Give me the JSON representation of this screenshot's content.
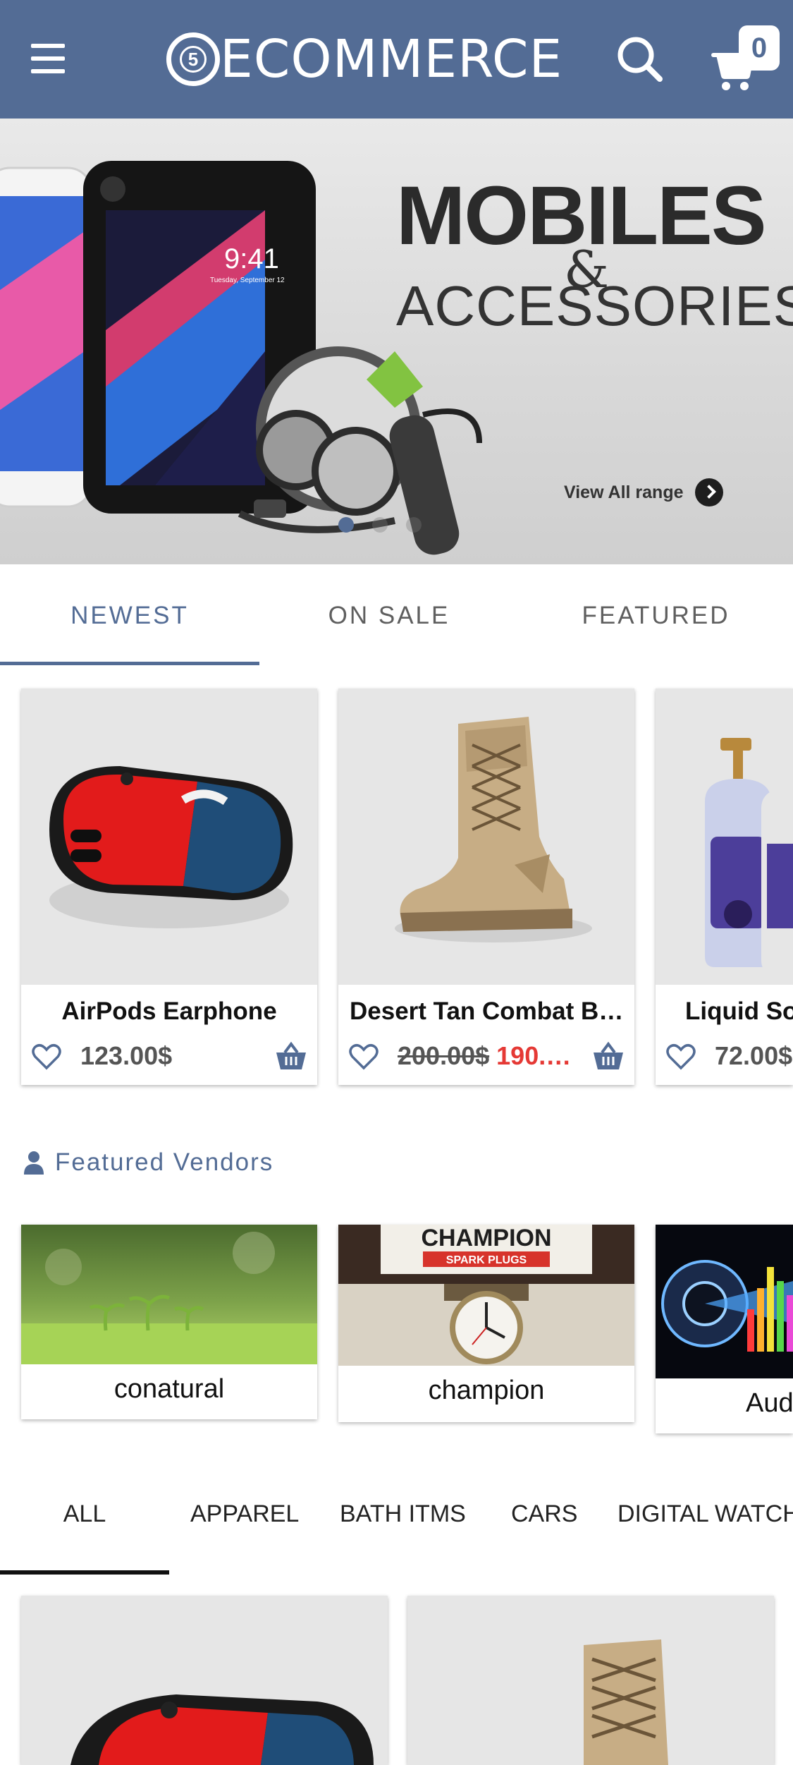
{
  "app_bar": {
    "brand_badge": "5",
    "brand_name": "ECOMMERCE",
    "cart_count": "0",
    "icons": [
      "menu-icon",
      "search-icon",
      "cart-icon"
    ],
    "color": "#536c95"
  },
  "banner": {
    "title": "MOBILES",
    "amp": "&",
    "subtitle": "ACCESSORIES",
    "phone_time": "9:41",
    "phone_date": "Tuesday, September 12",
    "link": "View All range",
    "slides": 3,
    "active_slide": 1
  },
  "product_tabs": [
    {
      "label": "NEWEST",
      "active": true
    },
    {
      "label": "ON SALE",
      "active": false
    },
    {
      "label": "FEATURED",
      "active": false
    }
  ],
  "products": [
    {
      "name": "AirPods Earphone",
      "price": "123.00$"
    },
    {
      "name": "Desert Tan Combat Bo…",
      "old_price": "200.00$",
      "sale_price": "190.…"
    },
    {
      "name": "Liquid Soa",
      "price": "72.00$"
    }
  ],
  "vendors": {
    "heading": "Featured Vendors",
    "items": [
      {
        "name": "conatural"
      },
      {
        "name": "champion",
        "sign_text": "CHAMPION",
        "sign_sub": "SPARK  PLUGS"
      },
      {
        "name": "Aud"
      }
    ]
  },
  "categories": [
    {
      "label": "ALL",
      "active": true
    },
    {
      "label": "APPAREL"
    },
    {
      "label": "BATH ITMS"
    },
    {
      "label": "CARS"
    },
    {
      "label": "DIGITAL WATCH"
    }
  ],
  "colors": {
    "primary": "#536c95",
    "sale": "#e53935",
    "text": "#111111"
  }
}
